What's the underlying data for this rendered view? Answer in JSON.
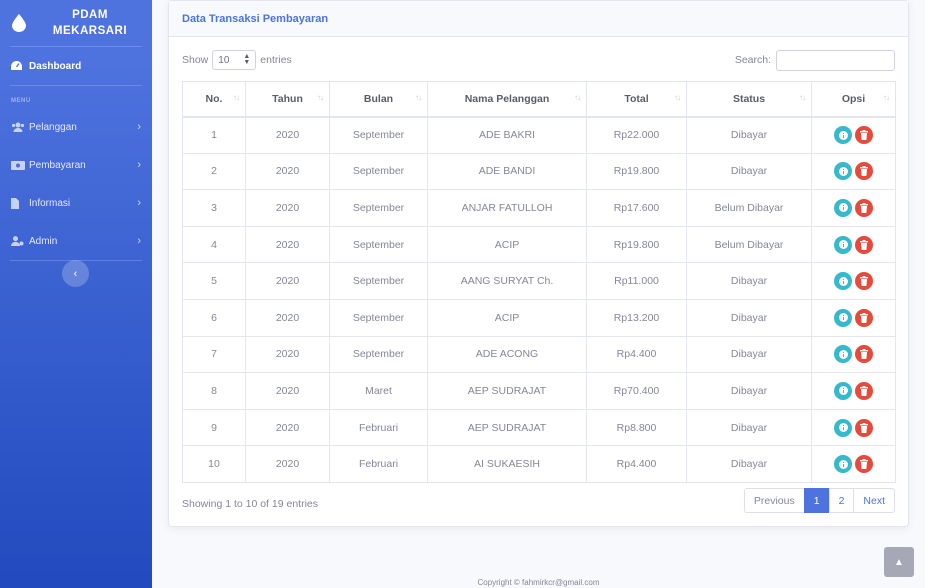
{
  "brand": {
    "line1": "PDAM",
    "line2": "MEKARSARI",
    "icon": "water-drop-icon"
  },
  "sidebar": {
    "dashboard": "Dashboard",
    "heading": "MENU",
    "items": [
      {
        "label": "Pelanggan",
        "icon": "users-icon"
      },
      {
        "label": "Pembayaran",
        "icon": "money-icon"
      },
      {
        "label": "Informasi",
        "icon": "file-icon"
      },
      {
        "label": "Admin",
        "icon": "user-cog-icon"
      }
    ],
    "toggle_icon": "chevron-left-icon"
  },
  "card": {
    "title": "Data Transaksi Pembayaran"
  },
  "controls": {
    "show_label": "Show",
    "entries_value": "10",
    "entries_label": "entries",
    "search_label": "Search:"
  },
  "table": {
    "headers": [
      "No.",
      "Tahun",
      "Bulan",
      "Nama Pelanggan",
      "Total",
      "Status",
      "Opsi"
    ],
    "rows": [
      [
        "1",
        "2020",
        "September",
        "ADE BAKRI",
        "Rp22.000",
        "Dibayar"
      ],
      [
        "2",
        "2020",
        "September",
        "ADE BANDI",
        "Rp19.800",
        "Dibayar"
      ],
      [
        "3",
        "2020",
        "September",
        "ANJAR FATULLOH",
        "Rp17.600",
        "Belum Dibayar"
      ],
      [
        "4",
        "2020",
        "September",
        "ACIP",
        "Rp19.800",
        "Belum Dibayar"
      ],
      [
        "5",
        "2020",
        "September",
        "AANG SURYAT Ch.",
        "Rp11.000",
        "Dibayar"
      ],
      [
        "6",
        "2020",
        "September",
        "ACIP",
        "Rp13.200",
        "Dibayar"
      ],
      [
        "7",
        "2020",
        "September",
        "ADE ACONG",
        "Rp4.400",
        "Dibayar"
      ],
      [
        "8",
        "2020",
        "Maret",
        "AEP SUDRAJAT",
        "Rp70.400",
        "Dibayar"
      ],
      [
        "9",
        "2020",
        "Februari",
        "AEP SUDRAJAT",
        "Rp8.800",
        "Dibayar"
      ],
      [
        "10",
        "2020",
        "Februari",
        "AI SUKAESIH",
        "Rp4.400",
        "Dibayar"
      ]
    ]
  },
  "footer": {
    "info": "Showing 1 to 10 of 19 entries",
    "pagination": [
      "Previous",
      "1",
      "2",
      "Next"
    ],
    "active_page": "1",
    "copyright": "Copyright © fahmirkcr@gmail.com"
  },
  "colors": {
    "primary": "#4e73df",
    "info": "#36b9cc",
    "danger": "#e74a3b"
  }
}
